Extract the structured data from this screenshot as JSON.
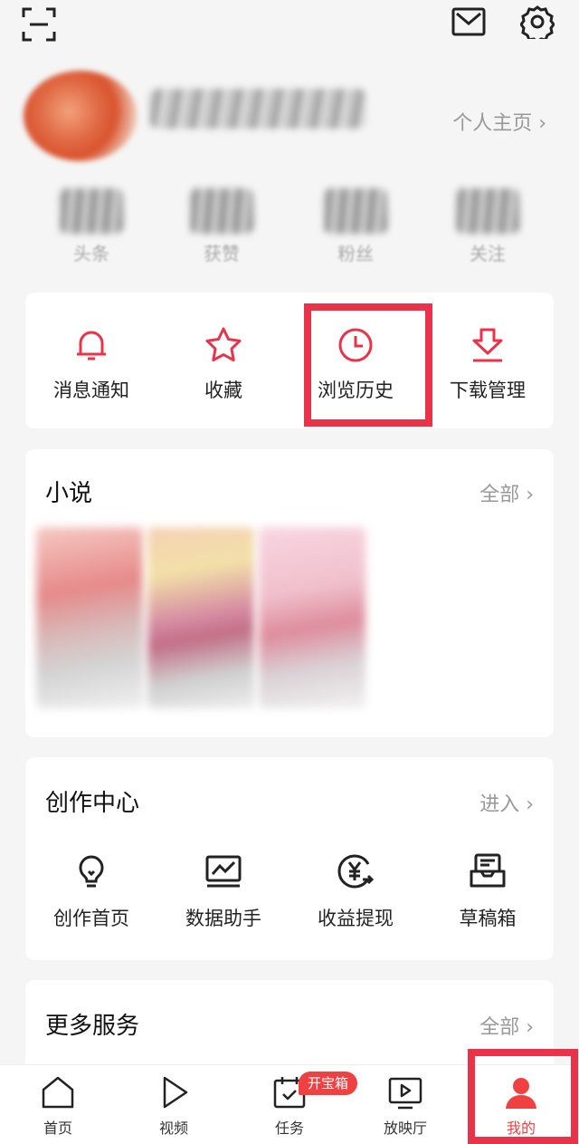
{
  "header": {
    "scan_icon": "scan-icon",
    "mail_icon": "mail-icon",
    "settings_icon": "gear-icon"
  },
  "profile": {
    "name": "",
    "homepage_label": "个人主页 ›",
    "stats": [
      {
        "label": "头条"
      },
      {
        "label": "获赞"
      },
      {
        "label": "粉丝"
      },
      {
        "label": "关注"
      }
    ]
  },
  "quick": {
    "items": [
      {
        "label": "消息通知",
        "icon": "bell-icon"
      },
      {
        "label": "收藏",
        "icon": "star-icon"
      },
      {
        "label": "浏览历史",
        "icon": "clock-icon"
      },
      {
        "label": "下载管理",
        "icon": "download-icon"
      }
    ]
  },
  "novel": {
    "title": "小说",
    "more_label": "全部 ›"
  },
  "creation": {
    "title": "创作中心",
    "more_label": "进入 ›",
    "items": [
      {
        "label": "创作首页",
        "icon": "lightbulb-icon"
      },
      {
        "label": "数据助手",
        "icon": "chart-icon"
      },
      {
        "label": "收益提现",
        "icon": "yuan-coin-icon"
      },
      {
        "label": "草稿箱",
        "icon": "draft-box-icon"
      }
    ]
  },
  "more_services": {
    "title": "更多服务",
    "more_label": "全部 ›"
  },
  "tabbar": {
    "badge": "开宝箱",
    "tabs": [
      {
        "label": "首页",
        "icon": "home-icon"
      },
      {
        "label": "视频",
        "icon": "play-icon"
      },
      {
        "label": "任务",
        "icon": "task-icon"
      },
      {
        "label": "放映厅",
        "icon": "tv-icon"
      },
      {
        "label": "我的",
        "icon": "user-icon"
      }
    ]
  },
  "colors": {
    "accent": "#e8334a",
    "brand_red": "#f04142",
    "muted": "#999999",
    "background": "#f5f5f5"
  }
}
